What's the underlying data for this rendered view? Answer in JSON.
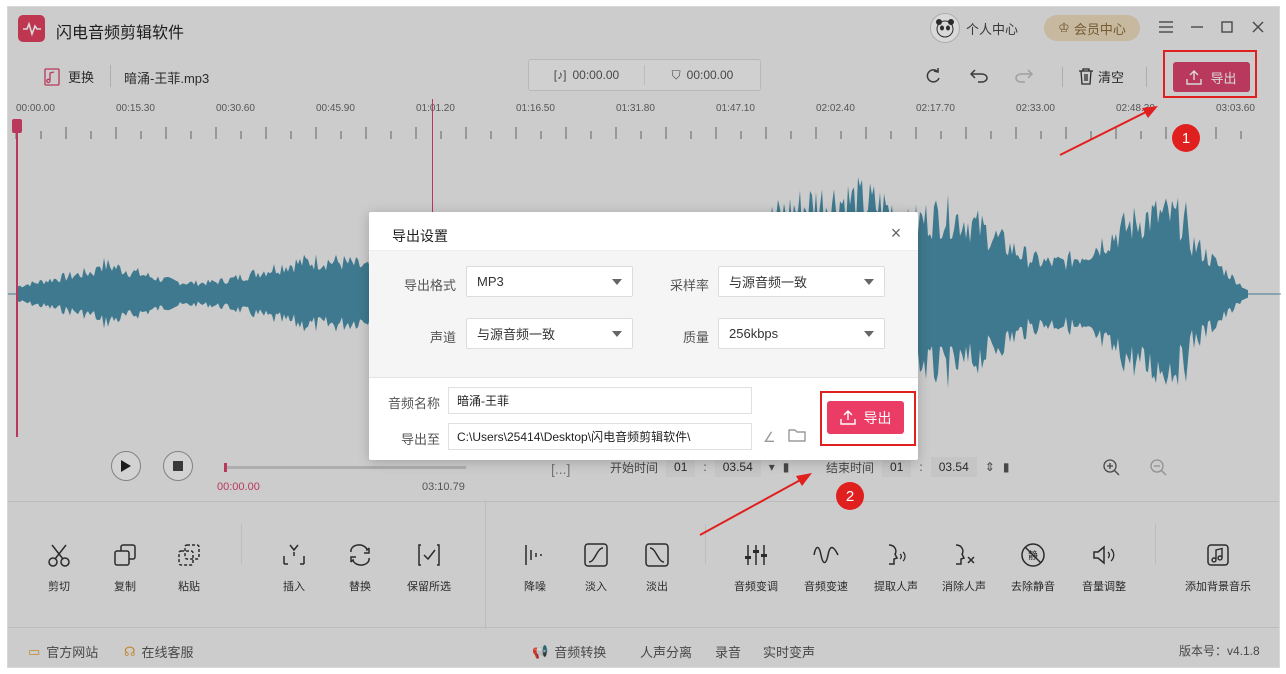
{
  "app": {
    "title": "闪电音频剪辑软件",
    "user_center": "个人中心",
    "vip_center": "会员中心"
  },
  "toolbar": {
    "change_label": "更换",
    "filename": "暗涌-王菲.mp3",
    "time1": "00:00.00",
    "time2": "00:00.00",
    "clear_label": "清空",
    "export_label": "导出"
  },
  "ruler": {
    "ticks": [
      "00:00.00",
      "00:15.30",
      "00:30.60",
      "00:45.90",
      "01:01.20",
      "01:16.50",
      "01:31.80",
      "01:47.10",
      "02:02.40",
      "02:17.70",
      "02:33.00",
      "02:48.30",
      "03:03.60"
    ]
  },
  "player": {
    "current_time": "00:00.00",
    "total_time": "03:10.79",
    "start_label": "开始时间",
    "start_min": "01",
    "start_sec": "03.54",
    "end_label": "结束时间",
    "end_min": "01",
    "end_sec": "03.54"
  },
  "tools": [
    {
      "label": "剪切",
      "icon": "scissors-icon"
    },
    {
      "label": "复制",
      "icon": "copy-icon"
    },
    {
      "label": "粘贴",
      "icon": "paste-icon"
    },
    {
      "label": "插入",
      "icon": "insert-icon"
    },
    {
      "label": "替换",
      "icon": "replace-icon"
    },
    {
      "label": "保留所选",
      "icon": "keep-selection-icon"
    },
    {
      "label": "降噪",
      "icon": "denoise-icon"
    },
    {
      "label": "淡入",
      "icon": "fade-in-icon"
    },
    {
      "label": "淡出",
      "icon": "fade-out-icon"
    },
    {
      "label": "音频变调",
      "icon": "pitch-icon"
    },
    {
      "label": "音频变速",
      "icon": "speed-icon"
    },
    {
      "label": "提取人声",
      "icon": "extract-voice-icon"
    },
    {
      "label": "消除人声",
      "icon": "remove-voice-icon"
    },
    {
      "label": "去除静音",
      "icon": "remove-silence-icon"
    },
    {
      "label": "音量调整",
      "icon": "volume-icon"
    },
    {
      "label": "添加背景音乐",
      "icon": "bg-music-icon"
    }
  ],
  "footer": {
    "website": "官方网站",
    "support": "在线客服",
    "convert": "音频转换",
    "separate": "人声分离",
    "record": "录音",
    "voice_change": "实时变声",
    "version": "版本号：v4.1.8"
  },
  "dialog": {
    "title": "导出设置",
    "format_label": "导出格式",
    "format_value": "MP3",
    "rate_label": "采样率",
    "rate_value": "与源音频一致",
    "channel_label": "声道",
    "channel_value": "与源音频一致",
    "quality_label": "质量",
    "quality_value": "256kbps",
    "name_label": "音频名称",
    "name_value": "暗涌-王菲",
    "path_label": "导出至",
    "path_value": "C:\\Users\\25414\\Desktop\\闪电音频剪辑软件\\",
    "export_label": "导出"
  },
  "annotations": {
    "step1": "1",
    "step2": "2"
  },
  "colors": {
    "accent": "#d9436c",
    "waveform": "#4b8fa8",
    "annotation": "#e0201f"
  }
}
